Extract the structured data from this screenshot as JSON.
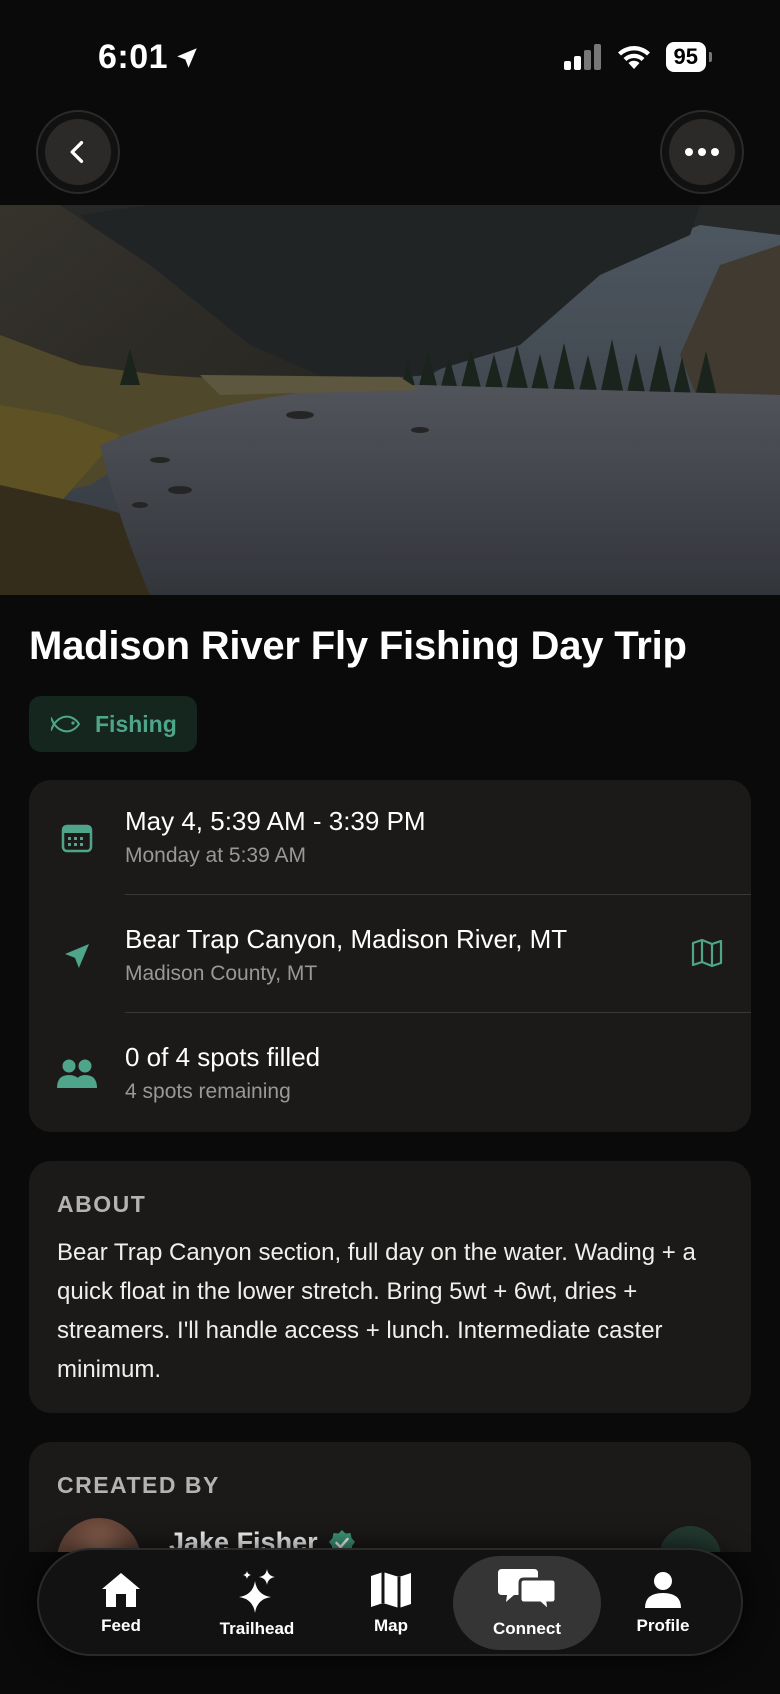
{
  "status": {
    "time": "6:01",
    "battery": "95"
  },
  "event": {
    "title": "Madison River Fly Fishing Day Trip",
    "category": "Fishing",
    "datetime": {
      "primary": "May 4, 5:39 AM - 3:39 PM",
      "secondary": "Monday at 5:39 AM"
    },
    "location": {
      "primary": "Bear Trap Canyon, Madison River, MT",
      "secondary": "Madison County, MT"
    },
    "spots": {
      "primary": "0 of 4 spots filled",
      "secondary": "4 spots remaining"
    }
  },
  "about": {
    "heading": "ABOUT",
    "text": "Bear Trap Canyon section, full day on the water. Wading + a quick float in the lower stretch. Bring 5wt + 6wt, dries + streamers. I'll handle access + lunch. Intermediate caster minimum."
  },
  "creator": {
    "heading": "CREATED BY",
    "name": "Jake Fisher"
  },
  "tabs": [
    {
      "label": "Feed",
      "icon": "home-icon"
    },
    {
      "label": "Trailhead",
      "icon": "sparkles-icon"
    },
    {
      "label": "Map",
      "icon": "map-icon"
    },
    {
      "label": "Connect",
      "icon": "chat-bubbles-icon",
      "active": true
    },
    {
      "label": "Profile",
      "icon": "person-icon"
    }
  ],
  "colors": {
    "accent": "#4fa58a",
    "card": "#1c1a19",
    "background": "#0a0a0a"
  }
}
